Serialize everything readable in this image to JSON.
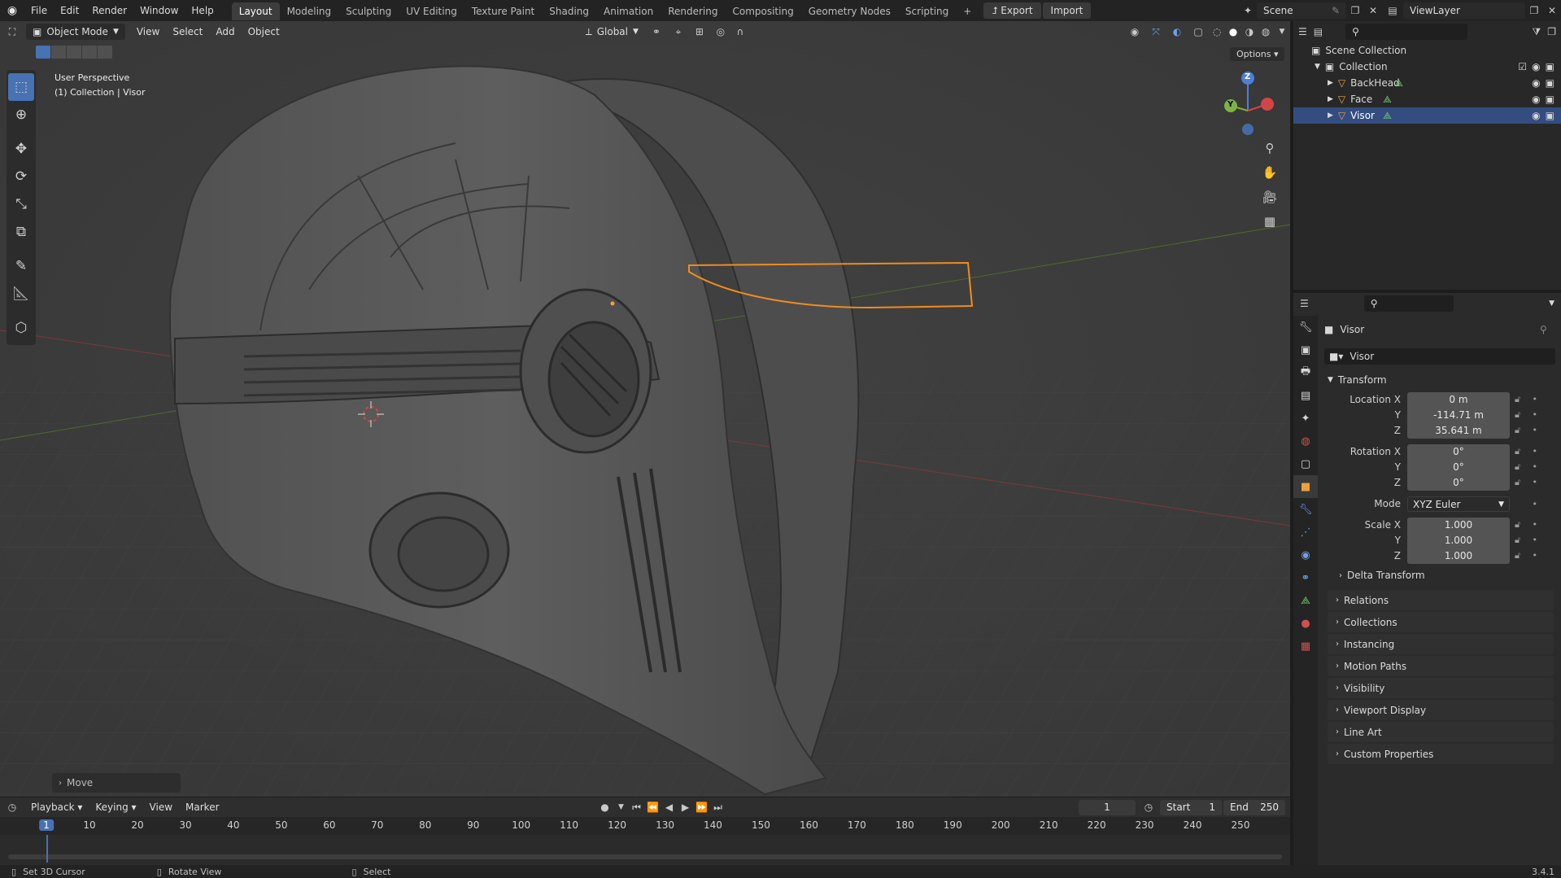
{
  "topbar": {
    "menus": [
      "File",
      "Edit",
      "Render",
      "Window",
      "Help"
    ],
    "workspaces": [
      "Layout",
      "Modeling",
      "Sculpting",
      "UV Editing",
      "Texture Paint",
      "Shading",
      "Animation",
      "Rendering",
      "Compositing",
      "Geometry Nodes",
      "Scripting"
    ],
    "active_workspace": "Layout",
    "add_tab": "+",
    "export_label": "Export",
    "import_label": "Import",
    "scene_name": "Scene",
    "view_layer": "ViewLayer"
  },
  "viewport": {
    "mode": "Object Mode",
    "menus": [
      "View",
      "Select",
      "Add",
      "Object"
    ],
    "transform_orientation": "Global",
    "options_label": "Options",
    "overlay_title": "User Perspective",
    "overlay_subtitle": "(1) Collection | Visor",
    "last_op": "Move",
    "gizmo": {
      "z": "Z",
      "y": "Y"
    }
  },
  "outliner": {
    "root": "Scene Collection",
    "collection": "Collection",
    "objects": [
      {
        "name": "BackHead",
        "selected": false
      },
      {
        "name": "Face",
        "selected": false
      },
      {
        "name": "Visor",
        "selected": true
      }
    ]
  },
  "properties": {
    "object_name": "Visor",
    "name_field": "Visor",
    "transform_label": "Transform",
    "location_label": "Location X",
    "location": {
      "x": "0 m",
      "y": "-114.71 m",
      "z": "35.641 m"
    },
    "rotation_label": "Rotation X",
    "rotation": {
      "x": "0°",
      "y": "0°",
      "z": "0°"
    },
    "axis_y": "Y",
    "axis_z": "Z",
    "mode_label": "Mode",
    "mode_value": "XYZ Euler",
    "scale_label": "Scale X",
    "scale": {
      "x": "1.000",
      "y": "1.000",
      "z": "1.000"
    },
    "delta_transform": "Delta Transform",
    "panels": [
      "Relations",
      "Collections",
      "Instancing",
      "Motion Paths",
      "Visibility",
      "Viewport Display",
      "Line Art",
      "Custom Properties"
    ]
  },
  "timeline": {
    "menus": [
      "Playback",
      "Keying",
      "View",
      "Marker"
    ],
    "current_frame": "1",
    "start_label": "Start",
    "start": "1",
    "end_label": "End",
    "end": "250",
    "ticks": [
      "1",
      "10",
      "20",
      "30",
      "40",
      "50",
      "60",
      "70",
      "80",
      "90",
      "100",
      "110",
      "120",
      "130",
      "140",
      "150",
      "160",
      "170",
      "180",
      "190",
      "200",
      "210",
      "220",
      "230",
      "240",
      "250"
    ]
  },
  "statusbar": {
    "left": "Set 3D Cursor",
    "middle": "Rotate View",
    "right": "Select",
    "version": "3.4.1"
  },
  "colors": {
    "accent": "#4772b3",
    "selection_outline": "#f08c1e",
    "bg_viewport": "#3c3c3c"
  }
}
